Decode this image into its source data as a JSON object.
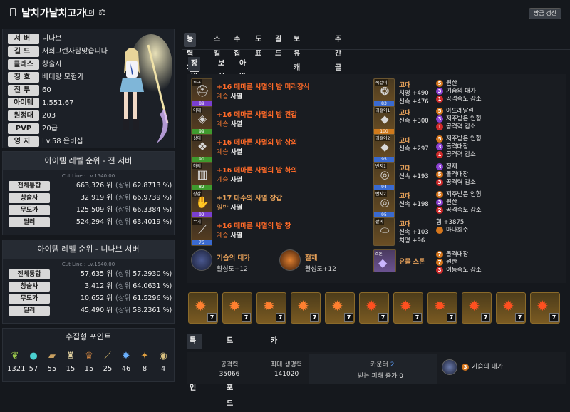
{
  "header": {
    "name": "날치가날치고가",
    "update_label": "방금 갱신"
  },
  "profile": [
    {
      "k": "server",
      "label": "서버",
      "value": "니나브"
    },
    {
      "k": "guild",
      "label": "길드",
      "value": "저희그런사람맞습니다"
    },
    {
      "k": "class",
      "label": "클래스",
      "value": "창술사"
    },
    {
      "k": "title",
      "label": "칭호",
      "value": "베테랑 모험가"
    },
    {
      "k": "battle",
      "label": "전투",
      "value": "60"
    },
    {
      "k": "item",
      "label": "아이템",
      "value": "1,551.67"
    },
    {
      "k": "expedition",
      "label": "원정대",
      "value": "203"
    },
    {
      "k": "pvp",
      "label": "PVP",
      "value": "20급"
    },
    {
      "k": "estate",
      "label": "영지",
      "value": "Lv.58 은비집"
    }
  ],
  "rank_all": {
    "title": "아이템 레벨 순위 - 전 서버",
    "cut": "Cut Line : Lv.1540.00",
    "rows": [
      {
        "label": "전체통합",
        "rank": "663,326",
        "unit": "위",
        "pre": "(상위",
        "pct": "62.8713 %)"
      },
      {
        "label": "창술사",
        "rank": "32,919",
        "unit": "위",
        "pre": "(상위",
        "pct": "66.9739 %)"
      },
      {
        "label": "무도가",
        "rank": "125,509",
        "unit": "위",
        "pre": "(상위",
        "pct": "66.3384 %)"
      },
      {
        "label": "딜러",
        "rank": "524,294",
        "unit": "위",
        "pre": "(상위",
        "pct": "63.4019 %)"
      }
    ]
  },
  "rank_server": {
    "title": "아이템 레벨 순위 - 니나브 서버",
    "cut": "Cut Line : Lv.1540.00",
    "rows": [
      {
        "label": "전체통합",
        "rank": "57,635",
        "unit": "위",
        "pre": "(상위",
        "pct": "57.2930 %)"
      },
      {
        "label": "창술사",
        "rank": "3,412",
        "unit": "위",
        "pre": "(상위",
        "pct": "64.0631 %)"
      },
      {
        "label": "무도가",
        "rank": "10,652",
        "unit": "위",
        "pre": "(상위",
        "pct": "61.5296 %)"
      },
      {
        "label": "딜러",
        "rank": "45,490",
        "unit": "위",
        "pre": "(상위",
        "pct": "58.2361 %)"
      }
    ]
  },
  "collect": {
    "title": "수집형 포인트",
    "items": [
      {
        "icon": "mokoko-seed-icon",
        "value": "1321"
      },
      {
        "icon": "island-heart-icon",
        "value": "57"
      },
      {
        "icon": "world-tree-leaf-icon",
        "value": "55"
      },
      {
        "icon": "igneas-token-icon",
        "value": "15"
      },
      {
        "icon": "art-icon",
        "value": "15"
      },
      {
        "icon": "voyage-icon",
        "value": "25"
      },
      {
        "icon": "giant-heart-icon",
        "value": "46"
      },
      {
        "icon": "orpheus-star-icon",
        "value": "8"
      },
      {
        "icon": "omnium-star-icon",
        "value": "4"
      }
    ]
  },
  "tabs_main": [
    "능력치",
    "스킬",
    "수집",
    "도표",
    "길드",
    "보유 캐릭터",
    "주간골드획득"
  ],
  "tabs_sub": [
    "장비",
    "보석",
    "아바타"
  ],
  "equipment": [
    {
      "slot": "투구",
      "q": "89",
      "name": "+16 메마른 사멸의 밤 머리장식",
      "tier": "계승",
      "set": "사멸",
      "qc": "#7a3fd0"
    },
    {
      "slot": "어깨",
      "q": "99",
      "name": "+16 메마른 사멸의 밤 견갑",
      "tier": "계승",
      "set": "사멸",
      "qc": "#3f9a2e"
    },
    {
      "slot": "상의",
      "q": "90",
      "name": "+16 메마른 사멸의 밤 상의",
      "tier": "계승",
      "set": "사멸",
      "qc": "#3f9a2e"
    },
    {
      "slot": "하의",
      "q": "82",
      "name": "+16 메마른 사멸의 밤 하의",
      "tier": "계승",
      "set": "사멸",
      "qc": "#3f9a2e"
    },
    {
      "slot": "장갑",
      "q": "92",
      "name": "+17 마수의 사멸 장갑",
      "tier": "일반",
      "set": "사멸",
      "qc": "#7a3fd0"
    },
    {
      "slot": "무기",
      "q": "75",
      "name": "+16 메마른 사멸의 밤 창",
      "tier": "계승",
      "set": "사멸",
      "qc": "#3a6ad0"
    }
  ],
  "accessories": [
    {
      "slot": "목걸이",
      "q": "83",
      "grade": "고대",
      "s1": "치명 +490",
      "s2": "신속 +476",
      "e": [
        [
          "5",
          "원한",
          "or"
        ],
        [
          "3",
          "기습의 대가",
          "pu"
        ],
        [
          "1",
          "공격속도 감소",
          "re"
        ]
      ]
    },
    {
      "slot": "귀걸이1",
      "q": "100",
      "grade": "고대",
      "s1": "신속 +300",
      "s2": "",
      "e": [
        [
          "5",
          "아드레날린",
          "or"
        ],
        [
          "3",
          "저주받은 인형",
          "pu"
        ],
        [
          "1",
          "공격력 감소",
          "re"
        ]
      ]
    },
    {
      "slot": "귀걸이2",
      "q": "95",
      "grade": "고대",
      "s1": "신속 +297",
      "s2": "",
      "e": [
        [
          "5",
          "저주받은 인형",
          "or"
        ],
        [
          "3",
          "돌격대장",
          "pu"
        ],
        [
          "1",
          "공격력 감소",
          "re"
        ]
      ]
    },
    {
      "slot": "반지1",
      "q": "94",
      "grade": "고대",
      "s1": "신속 +193",
      "s2": "",
      "e": [
        [
          "3",
          "정제",
          "pu"
        ],
        [
          "5",
          "돌격대장",
          "or"
        ],
        [
          "3",
          "공격력 감소",
          "re"
        ]
      ]
    },
    {
      "slot": "반지2",
      "q": "95",
      "grade": "고대",
      "s1": "신속 +198",
      "s2": "",
      "e": [
        [
          "5",
          "저주받은 인형",
          "or"
        ],
        [
          "3",
          "원한",
          "pu"
        ],
        [
          "2",
          "공격속도 감소",
          "re"
        ]
      ]
    },
    {
      "slot": "팔찌",
      "q": "",
      "grade": "고대",
      "s1": "신속 +103",
      "s2": "치명 +96",
      "e": [
        [
          "",
          "힘 +3875",
          ""
        ],
        [
          "",
          "마나회수",
          "or"
        ]
      ]
    }
  ],
  "extras": {
    "bracelet": {
      "name": "기습의 대가",
      "level": "활성도+12"
    },
    "special": {
      "name": "절제",
      "level": "활성도+12"
    },
    "stone": {
      "slot": "스톤",
      "name": "유물 스톤",
      "e": [
        [
          "7",
          "돌격대장",
          "or"
        ],
        [
          "7",
          "원한",
          "or"
        ],
        [
          "3",
          "이동속도 감소",
          "re"
        ]
      ]
    }
  },
  "gems": [
    "7",
    "7",
    "7",
    "7",
    "7",
    "7",
    "7",
    "7",
    "7",
    "7",
    "7"
  ],
  "tabs_bottom": [
    "특성/각인",
    "트라이포드",
    "카드"
  ],
  "stats": {
    "attack_label": "공격력",
    "attack": "35066",
    "hp_label": "최대 생명력",
    "hp": "141020",
    "counter_label": "카운터",
    "counter": "2",
    "heal_label": "받는 피해 증가",
    "heal": "0",
    "engrave_level": "3",
    "engrave_name": "기습의 대가"
  }
}
